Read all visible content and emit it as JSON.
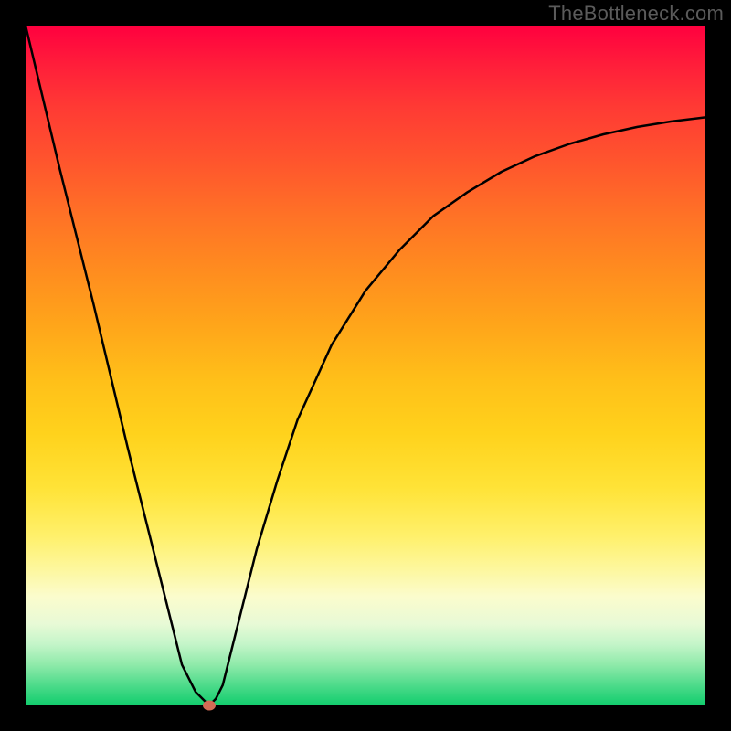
{
  "watermark": "TheBottleneck.com",
  "chart_data": {
    "type": "line",
    "title": "",
    "xlabel": "",
    "ylabel": "",
    "xlim": [
      0,
      100
    ],
    "ylim": [
      0,
      100
    ],
    "grid": false,
    "legend": false,
    "background_gradient": {
      "top_color": "#ff003f",
      "bottom_color": "#11cd6d"
    },
    "series": [
      {
        "name": "bottle-curve",
        "color": "#000000",
        "x": [
          0,
          5,
          10,
          15,
          20,
          23,
          25,
          27,
          28,
          29,
          30,
          32,
          34,
          37,
          40,
          45,
          50,
          55,
          60,
          65,
          70,
          75,
          80,
          85,
          90,
          95,
          100
        ],
        "y": [
          100,
          79,
          59,
          38,
          18,
          6,
          2,
          0,
          1,
          3,
          7,
          15,
          23,
          33,
          42,
          53,
          61,
          67,
          72,
          75.5,
          78.5,
          80.8,
          82.6,
          84,
          85.1,
          85.9,
          86.5
        ]
      }
    ],
    "marker": {
      "name": "optimal-point",
      "x": 27,
      "y": 0,
      "color": "#d36b55"
    }
  }
}
